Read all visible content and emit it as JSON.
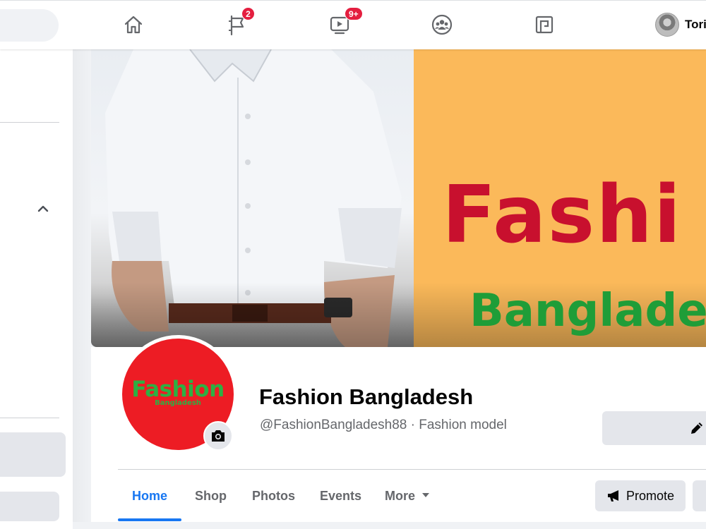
{
  "topbar": {
    "nav": [
      {
        "name": "home",
        "icon": "home-icon"
      },
      {
        "name": "pages",
        "icon": "flag-icon",
        "badge": "2"
      },
      {
        "name": "watch",
        "icon": "video-icon",
        "badge": "9+"
      },
      {
        "name": "groups",
        "icon": "groups-icon"
      },
      {
        "name": "gaming",
        "icon": "gaming-icon"
      }
    ],
    "profile_name": "Tori"
  },
  "cover": {
    "headline": "Fashi",
    "subline": "Banglade"
  },
  "page": {
    "logo_text": "Fashion",
    "logo_subtext": "Bangladesh",
    "name": "Fashion Bangladesh",
    "subtitle": "@FashionBangladesh88 · Fashion model"
  },
  "tabs": [
    {
      "label": "Home",
      "active": true
    },
    {
      "label": "Shop"
    },
    {
      "label": "Photos"
    },
    {
      "label": "Events"
    },
    {
      "label": "More"
    }
  ],
  "actions": {
    "promote_label": "Promote"
  },
  "colors": {
    "accent": "#1877f2",
    "badge": "#e41e3f",
    "cover_background": "#fbb95a",
    "cover_headline": "#c8102e",
    "cover_subline": "#1f9d38",
    "logo_background": "#ed1c24"
  }
}
